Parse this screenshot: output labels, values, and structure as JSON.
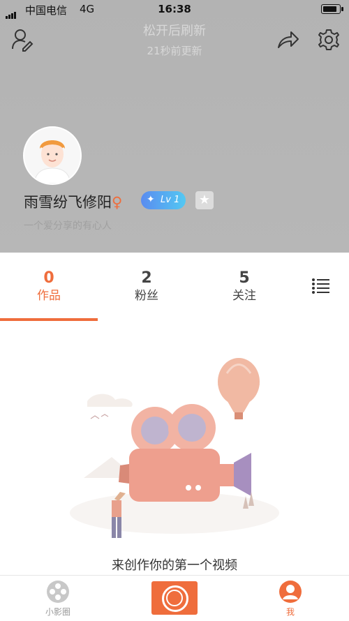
{
  "status_bar": {
    "carrier": "中国电信",
    "network": "4G",
    "time": "16:38"
  },
  "refresh": {
    "title": "松开后刷新",
    "subtitle": "21秒前更新"
  },
  "profile": {
    "name": "雨雪纷飞修阳",
    "gender_symbol": "♀",
    "level": "Lv 1",
    "bio": "一个爱分享的有心人"
  },
  "tabs": [
    {
      "count": "0",
      "label": "作品"
    },
    {
      "count": "2",
      "label": "粉丝"
    },
    {
      "count": "5",
      "label": "关注"
    }
  ],
  "empty_state": {
    "message": "来创作你的第一个视频"
  },
  "tab_bar": {
    "left_label": "小影圈",
    "right_label": "我"
  },
  "colors": {
    "accent": "#ef6d3c",
    "header_bg": "#b5b5b5"
  }
}
